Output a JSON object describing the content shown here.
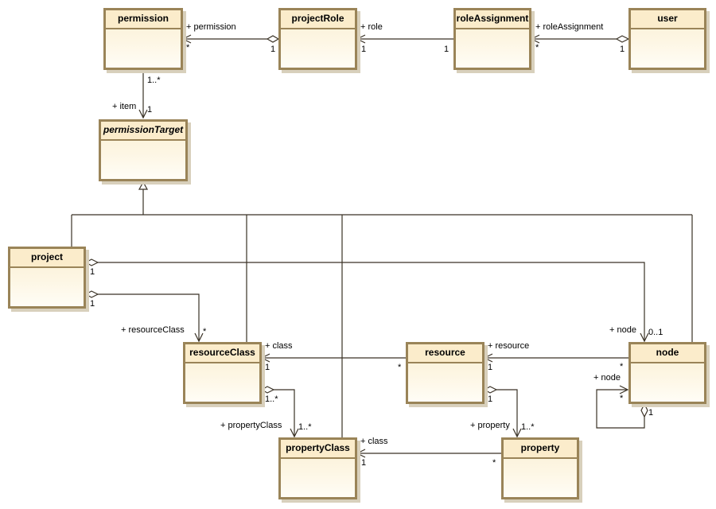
{
  "diagram": {
    "type": "UML class diagram",
    "classes": [
      {
        "id": "permission",
        "name": "permission",
        "abstract": false
      },
      {
        "id": "projectRole",
        "name": "projectRole",
        "abstract": false
      },
      {
        "id": "roleAssignment",
        "name": "roleAssignment",
        "abstract": false
      },
      {
        "id": "user",
        "name": "user",
        "abstract": false
      },
      {
        "id": "permissionTarget",
        "name": "permissionTarget",
        "abstract": true
      },
      {
        "id": "project",
        "name": "project",
        "abstract": false
      },
      {
        "id": "resourceClass",
        "name": "resourceClass",
        "abstract": false
      },
      {
        "id": "resource",
        "name": "resource",
        "abstract": false
      },
      {
        "id": "node",
        "name": "node",
        "abstract": false
      },
      {
        "id": "propertyClass",
        "name": "propertyClass",
        "abstract": false
      },
      {
        "id": "property",
        "name": "property",
        "abstract": false
      }
    ],
    "associations": [
      {
        "from": "projectRole",
        "to": "permission",
        "kind": "aggregation",
        "role": "+ permission",
        "from_mult": "1",
        "to_mult": "*"
      },
      {
        "from": "roleAssignment",
        "to": "projectRole",
        "kind": "association",
        "role": "+ role",
        "from_mult": "1",
        "to_mult": "1"
      },
      {
        "from": "user",
        "to": "roleAssignment",
        "kind": "aggregation",
        "role": "+ roleAssignment",
        "from_mult": "1",
        "to_mult": "*"
      },
      {
        "from": "permission",
        "to": "permissionTarget",
        "kind": "association",
        "role": "+ item",
        "from_mult": "1..*",
        "to_mult": "1"
      },
      {
        "from": "project",
        "to": "node",
        "kind": "aggregation",
        "role": "+ node",
        "from_mult": "1",
        "to_mult": "0..1"
      },
      {
        "from": "project",
        "to": "resourceClass",
        "kind": "aggregation",
        "role": "+ resourceClass",
        "from_mult": "1",
        "to_mult": "*"
      },
      {
        "from": "resource",
        "to": "resourceClass",
        "kind": "association",
        "role": "+ class",
        "from_mult": "*",
        "to_mult": "1"
      },
      {
        "from": "node",
        "to": "resource",
        "kind": "association",
        "role": "+ resource",
        "from_mult": "*",
        "to_mult": "1"
      },
      {
        "from": "node",
        "to": "node",
        "kind": "aggregation",
        "role": "+ node",
        "from_mult": "1",
        "to_mult": "*"
      },
      {
        "from": "resourceClass",
        "to": "propertyClass",
        "kind": "aggregation",
        "role": "+ propertyClass",
        "from_mult": "1..*",
        "to_mult": "1..*"
      },
      {
        "from": "resource",
        "to": "property",
        "kind": "aggregation",
        "role": "+ property",
        "from_mult": "1",
        "to_mult": "1..*"
      },
      {
        "from": "property",
        "to": "propertyClass",
        "kind": "association",
        "role": "+ class",
        "from_mult": "*",
        "to_mult": "1"
      }
    ],
    "generalizations": [
      {
        "parent": "permissionTarget",
        "children": [
          "project",
          "resourceClass",
          "propertyClass",
          "node"
        ]
      }
    ],
    "colors": {
      "class_border": "#9a8458",
      "class_header": "#fbeccb",
      "class_fill": "#fdf6e4",
      "line": "#3a3226",
      "shadow": "#d8d0bc"
    }
  }
}
